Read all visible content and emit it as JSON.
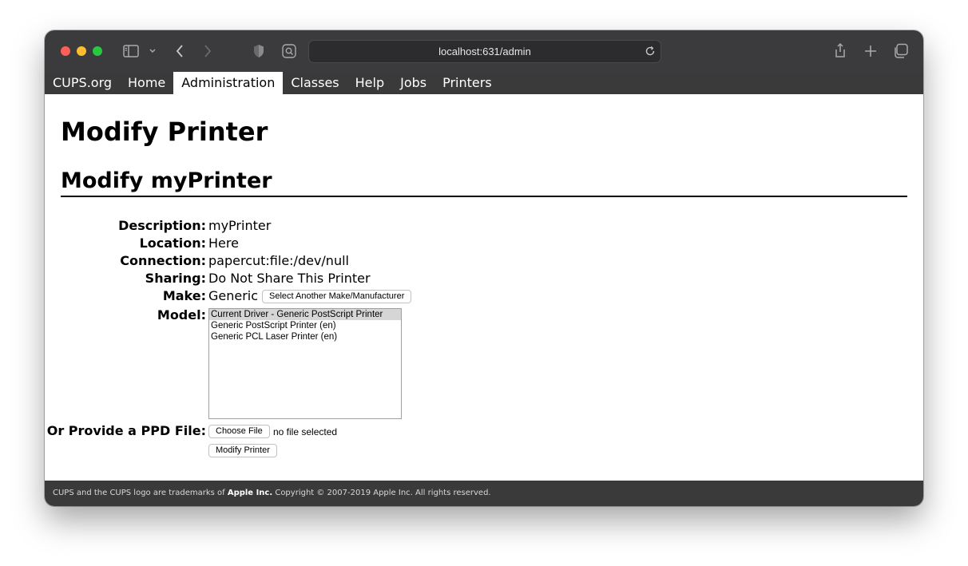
{
  "browser": {
    "url": "localhost:631/admin",
    "icons": [
      "sidebar-icon",
      "chevron-down-icon",
      "back-icon",
      "forward-icon",
      "shield-icon",
      "reader-icon",
      "reload-icon",
      "share-icon",
      "plus-icon",
      "tabs-icon"
    ]
  },
  "nav": {
    "items": [
      "CUPS.org",
      "Home",
      "Administration",
      "Classes",
      "Help",
      "Jobs",
      "Printers"
    ],
    "active": "Administration"
  },
  "page": {
    "title": "Modify Printer",
    "subtitle": "Modify myPrinter"
  },
  "form": {
    "description_label": "Description:",
    "description_value": "myPrinter",
    "location_label": "Location:",
    "location_value": "Here",
    "connection_label": "Connection:",
    "connection_value": "papercut:file:/dev/null",
    "sharing_label": "Sharing:",
    "sharing_value": "Do Not Share This Printer",
    "make_label": "Make:",
    "make_value": "Generic",
    "make_button": "Select Another Make/Manufacturer",
    "model_label": "Model:",
    "model_options": [
      "Current Driver - Generic PostScript Printer",
      "Generic PostScript Printer (en)",
      "Generic PCL Laser Printer (en)"
    ],
    "ppd_label": "Or Provide a PPD File:",
    "choose_file_button": "Choose File",
    "no_file_text": "no file selected",
    "submit_button": "Modify Printer"
  },
  "footer": {
    "prefix": "CUPS and the CUPS logo are trademarks of ",
    "company": "Apple Inc.",
    "suffix": " Copyright © 2007-2019 Apple Inc. All rights reserved."
  },
  "colors": {
    "titlebar": "#3b3b3d",
    "nav_bg": "#3a3a3a",
    "traffic_red": "#ff5f57",
    "traffic_yellow": "#febc2e",
    "traffic_green": "#28c840"
  }
}
